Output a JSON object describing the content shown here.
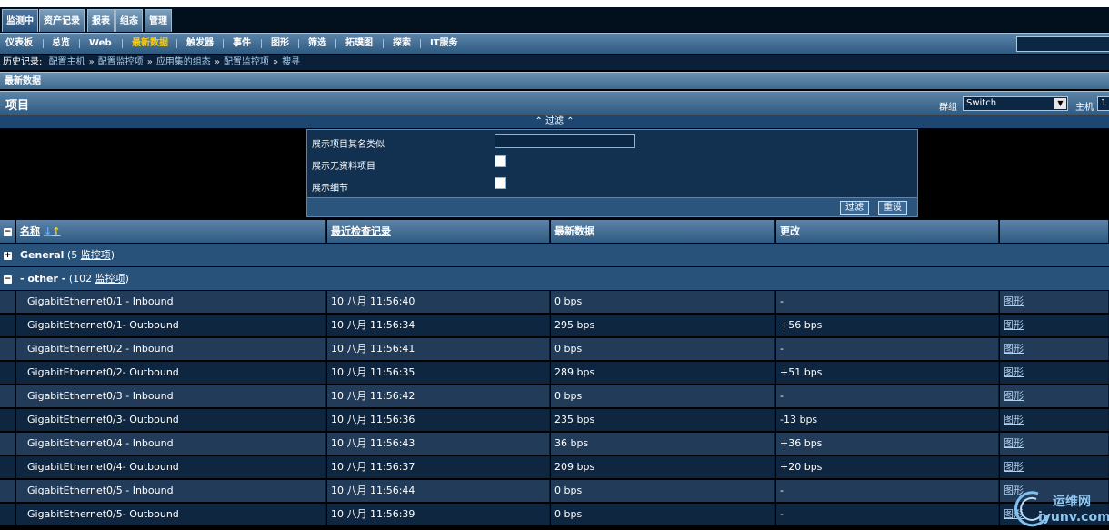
{
  "main_nav": [
    "监测中",
    "资产记录",
    "报表",
    "组态",
    "管理"
  ],
  "sub_nav": [
    "仪表板",
    "总览",
    "Web",
    "最新数据",
    "触发器",
    "事件",
    "图形",
    "筛选",
    "拓璞图",
    "探索",
    "IT服务"
  ],
  "history": {
    "label": "历史记录:",
    "links": [
      "配置主机",
      "配置监控项",
      "应用集的组态",
      "配置监控项",
      "搜寻"
    ],
    "separator": "»"
  },
  "section_title": "最新数据",
  "items_title": "项目",
  "group_label": "群组",
  "group_value": "Switch",
  "host_label": "主机",
  "host_value": "1",
  "filter_toggle": "⌃ 过滤 ⌃",
  "filter": {
    "name_like_label": "展示项目其名类似",
    "name_like_value": "",
    "no_data_label": "展示无资料项目",
    "details_label": "展示细节",
    "filter_button": "过滤",
    "reset_button": "重设"
  },
  "table": {
    "headers": [
      "名称",
      "最近检查记录",
      "最新数据",
      "更改",
      ""
    ],
    "groups": [
      {
        "name": "General",
        "count_prefix": "(5 ",
        "count_link": "监控项",
        "count_suffix": ")",
        "expanded": false
      },
      {
        "name": "- other -",
        "count_prefix": "(102 ",
        "count_link": "监控项",
        "count_suffix": ")",
        "expanded": true
      }
    ],
    "rows": [
      {
        "name": "GigabitEthernet0/1 - Inbound",
        "last_check": "10 八月 11:56:40",
        "last_value": "0 bps",
        "change": "-",
        "graph": "图形"
      },
      {
        "name": "GigabitEthernet0/1- Outbound",
        "last_check": "10 八月 11:56:34",
        "last_value": "295 bps",
        "change": "+56 bps",
        "graph": "图形"
      },
      {
        "name": "GigabitEthernet0/2 - Inbound",
        "last_check": "10 八月 11:56:41",
        "last_value": "0 bps",
        "change": "-",
        "graph": "图形"
      },
      {
        "name": "GigabitEthernet0/2- Outbound",
        "last_check": "10 八月 11:56:35",
        "last_value": "289 bps",
        "change": "+51 bps",
        "graph": "图形"
      },
      {
        "name": "GigabitEthernet0/3 - Inbound",
        "last_check": "10 八月 11:56:42",
        "last_value": "0 bps",
        "change": "-",
        "graph": "图形"
      },
      {
        "name": "GigabitEthernet0/3- Outbound",
        "last_check": "10 八月 11:56:36",
        "last_value": "235 bps",
        "change": "-13 bps",
        "graph": "图形"
      },
      {
        "name": "GigabitEthernet0/4 - Inbound",
        "last_check": "10 八月 11:56:43",
        "last_value": "36 bps",
        "change": "+36 bps",
        "graph": "图形"
      },
      {
        "name": "GigabitEthernet0/4- Outbound",
        "last_check": "10 八月 11:56:37",
        "last_value": "209 bps",
        "change": "+20 bps",
        "graph": "图形"
      },
      {
        "name": "GigabitEthernet0/5 - Inbound",
        "last_check": "10 八月 11:56:44",
        "last_value": "0 bps",
        "change": "-",
        "graph": "图形"
      },
      {
        "name": "GigabitEthernet0/5- Outbound",
        "last_check": "10 八月 11:56:39",
        "last_value": "0 bps",
        "change": "-",
        "graph": "图形"
      }
    ]
  },
  "watermark": {
    "line1": "运维网",
    "line2": "iyunv.com"
  }
}
